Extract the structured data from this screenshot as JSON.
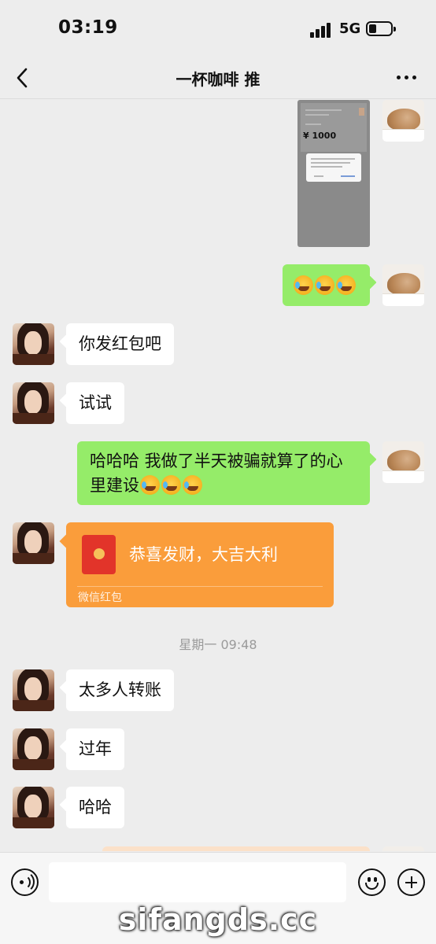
{
  "status_bar": {
    "time": "03:19",
    "network": "5G",
    "battery_level": 0.25
  },
  "nav": {
    "back_icon": "chevron-left-icon",
    "title": "一杯咖啡 推",
    "more_icon": "more-dots-icon"
  },
  "messages": [
    {
      "type": "image",
      "sender": "self",
      "preview_amount": "¥ 1000"
    },
    {
      "type": "emoji",
      "sender": "self",
      "emoji_count": 3,
      "emoji_icon": "laugh-cry-emoji"
    },
    {
      "type": "text",
      "sender": "other",
      "text": "你发红包吧"
    },
    {
      "type": "text",
      "sender": "other",
      "text": "试试"
    },
    {
      "type": "text",
      "sender": "self",
      "text_line1": "哈哈哈 我做了半天被骗就算了的心",
      "text_line2": "里建设",
      "emoji_count": 3
    },
    {
      "type": "red_packet",
      "sender": "other",
      "title": "恭喜发财，大吉大利",
      "caption": "微信红包"
    },
    {
      "type": "timestamp",
      "text": "星期一 09:48"
    },
    {
      "type": "text",
      "sender": "other",
      "text": "太多人转账"
    },
    {
      "type": "text",
      "sender": "other",
      "text": "过年"
    },
    {
      "type": "text",
      "sender": "other",
      "text": "哈哈"
    }
  ],
  "input_bar": {
    "voice_icon": "voice-icon",
    "input_value": "",
    "emoji_icon": "smiley-icon",
    "plus_icon": "plus-icon"
  },
  "watermark": "sifangds.cc",
  "colors": {
    "background": "#ededed",
    "self_bubble": "#95ec69",
    "other_bubble": "#ffffff",
    "red_packet": "#fa9d3b"
  }
}
